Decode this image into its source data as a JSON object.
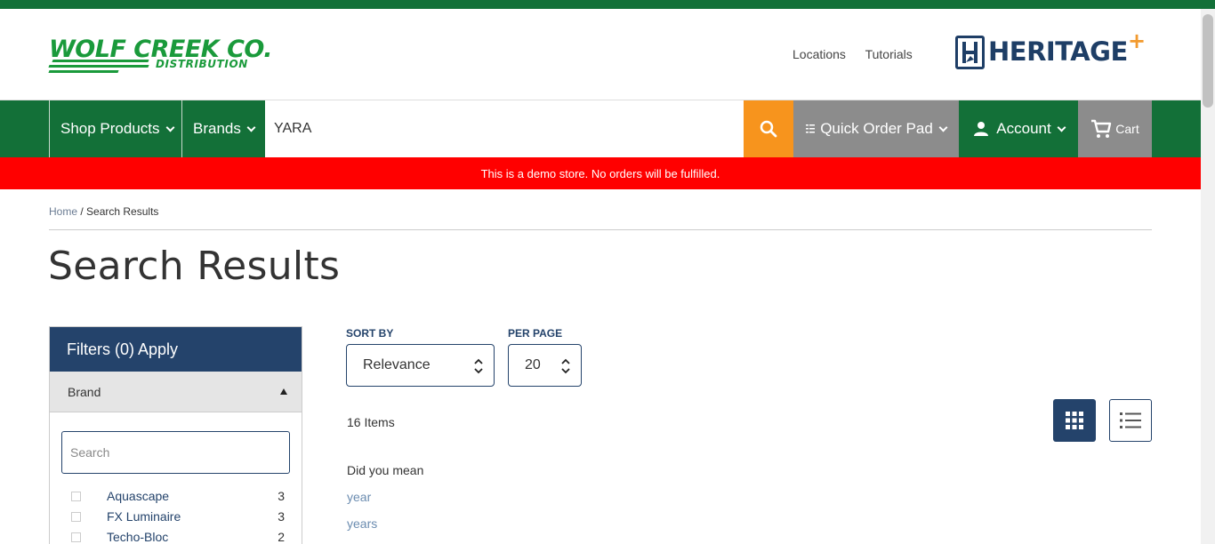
{
  "header": {
    "logo_wcc_line1": "WOLF CREEK CO.",
    "logo_wcc_line2": "DISTRIBUTION",
    "links": [
      "Locations",
      "Tutorials"
    ],
    "logo_heritage": "HERITAGE",
    "logo_heritage_plus": "+"
  },
  "nav": {
    "shop_products": "Shop Products",
    "brands": "Brands",
    "search_value": "YARA",
    "search_icon": "search-icon",
    "quick_order_pad": "Quick Order Pad",
    "account": "Account",
    "cart": "Cart"
  },
  "banner": "This is a demo store. No orders will be fulfilled.",
  "breadcrumb": {
    "home": "Home",
    "separator": " / ",
    "current": "Search Results"
  },
  "page_title": "Search Results",
  "filters": {
    "title": "Filters (0) Apply",
    "brand_label": "Brand",
    "search_placeholder": "Search",
    "items": [
      {
        "label": "Aquascape",
        "count": "3"
      },
      {
        "label": "FX Luminaire",
        "count": "3"
      },
      {
        "label": "Techo-Bloc",
        "count": "2"
      }
    ]
  },
  "sort": {
    "sort_label": "SORT BY",
    "sort_value": "Relevance",
    "per_page_label": "PER PAGE",
    "per_page_value": "20"
  },
  "results": {
    "count": "16 Items",
    "did_you_mean": "Did you mean",
    "suggestions": [
      "year",
      "years"
    ]
  },
  "colors": {
    "brand_green": "#137038",
    "logo_green": "#1a9a3b",
    "navy": "#24436b",
    "orange": "#f7941d",
    "banner_red": "#ff0000",
    "gray_button": "#8c8c8c"
  }
}
